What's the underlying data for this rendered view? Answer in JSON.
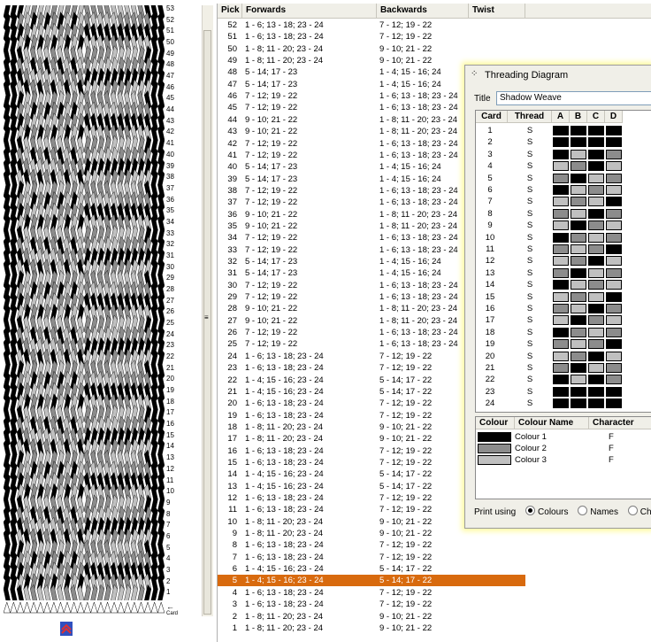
{
  "weave": {
    "colors": {
      "c1": "#000000",
      "c2": "#8c8c8c",
      "c3": "#c0c0c0"
    },
    "pick_numbers": [
      "53",
      "52",
      "51",
      "50",
      "49",
      "48",
      "47",
      "46",
      "45",
      "44",
      "43",
      "42",
      "41",
      "40",
      "39",
      "38",
      "37",
      "36",
      "35",
      "34",
      "33",
      "32",
      "31",
      "30",
      "29",
      "28",
      "27",
      "26",
      "25",
      "24",
      "23",
      "22",
      "21",
      "20",
      "19",
      "18",
      "17",
      "16",
      "15",
      "14",
      "13",
      "12",
      "11",
      "10",
      "9",
      "8",
      "7",
      "6",
      "5",
      "4",
      "3",
      "2",
      "1"
    ],
    "arrow_label": "←",
    "card_label": "Card"
  },
  "list": {
    "headers": {
      "pick": "Pick",
      "forwards": "Forwards",
      "backwards": "Backwards",
      "twist": "Twist"
    },
    "rows": [
      {
        "pick": "52",
        "fwd": "1 - 6; 13 - 18; 23 - 24",
        "bwd": "7 - 12; 19 - 22"
      },
      {
        "pick": "51",
        "fwd": "1 - 6; 13 - 18; 23 - 24",
        "bwd": "7 - 12; 19 - 22"
      },
      {
        "pick": "50",
        "fwd": "1 - 8; 11 - 20; 23 - 24",
        "bwd": "9 - 10; 21 - 22"
      },
      {
        "pick": "49",
        "fwd": "1 - 8; 11 - 20; 23 - 24",
        "bwd": "9 - 10; 21 - 22"
      },
      {
        "pick": "48",
        "fwd": "5 - 14; 17 - 23",
        "bwd": "1 - 4; 15 - 16; 24"
      },
      {
        "pick": "47",
        "fwd": "5 - 14; 17 - 23",
        "bwd": "1 - 4; 15 - 16; 24"
      },
      {
        "pick": "46",
        "fwd": "7 - 12; 19 - 22",
        "bwd": "1 - 6; 13 - 18; 23 - 24"
      },
      {
        "pick": "45",
        "fwd": "7 - 12; 19 - 22",
        "bwd": "1 - 6; 13 - 18; 23 - 24"
      },
      {
        "pick": "44",
        "fwd": "9 - 10; 21 - 22",
        "bwd": "1 - 8; 11 - 20; 23 - 24"
      },
      {
        "pick": "43",
        "fwd": "9 - 10; 21 - 22",
        "bwd": "1 - 8; 11 - 20; 23 - 24"
      },
      {
        "pick": "42",
        "fwd": "7 - 12; 19 - 22",
        "bwd": "1 - 6; 13 - 18; 23 - 24"
      },
      {
        "pick": "41",
        "fwd": "7 - 12; 19 - 22",
        "bwd": "1 - 6; 13 - 18; 23 - 24"
      },
      {
        "pick": "40",
        "fwd": "5 - 14; 17 - 23",
        "bwd": "1 - 4; 15 - 16; 24"
      },
      {
        "pick": "39",
        "fwd": "5 - 14; 17 - 23",
        "bwd": "1 - 4; 15 - 16; 24"
      },
      {
        "pick": "38",
        "fwd": "7 - 12; 19 - 22",
        "bwd": "1 - 6; 13 - 18; 23 - 24"
      },
      {
        "pick": "37",
        "fwd": "7 - 12; 19 - 22",
        "bwd": "1 - 6; 13 - 18; 23 - 24"
      },
      {
        "pick": "36",
        "fwd": "9 - 10; 21 - 22",
        "bwd": "1 - 8; 11 - 20; 23 - 24"
      },
      {
        "pick": "35",
        "fwd": "9 - 10; 21 - 22",
        "bwd": "1 - 8; 11 - 20; 23 - 24"
      },
      {
        "pick": "34",
        "fwd": "7 - 12; 19 - 22",
        "bwd": "1 - 6; 13 - 18; 23 - 24"
      },
      {
        "pick": "33",
        "fwd": "7 - 12; 19 - 22",
        "bwd": "1 - 6; 13 - 18; 23 - 24"
      },
      {
        "pick": "32",
        "fwd": "5 - 14; 17 - 23",
        "bwd": "1 - 4; 15 - 16; 24"
      },
      {
        "pick": "31",
        "fwd": "5 - 14; 17 - 23",
        "bwd": "1 - 4; 15 - 16; 24"
      },
      {
        "pick": "30",
        "fwd": "7 - 12; 19 - 22",
        "bwd": "1 - 6; 13 - 18; 23 - 24"
      },
      {
        "pick": "29",
        "fwd": "7 - 12; 19 - 22",
        "bwd": "1 - 6; 13 - 18; 23 - 24"
      },
      {
        "pick": "28",
        "fwd": "9 - 10; 21 - 22",
        "bwd": "1 - 8; 11 - 20; 23 - 24"
      },
      {
        "pick": "27",
        "fwd": "9 - 10; 21 - 22",
        "bwd": "1 - 8; 11 - 20; 23 - 24"
      },
      {
        "pick": "26",
        "fwd": "7 - 12; 19 - 22",
        "bwd": "1 - 6; 13 - 18; 23 - 24"
      },
      {
        "pick": "25",
        "fwd": "7 - 12; 19 - 22",
        "bwd": "1 - 6; 13 - 18; 23 - 24"
      },
      {
        "pick": "24",
        "fwd": "1 - 6; 13 - 18; 23 - 24",
        "bwd": "7 - 12; 19 - 22"
      },
      {
        "pick": "23",
        "fwd": "1 - 6; 13 - 18; 23 - 24",
        "bwd": "7 - 12; 19 - 22"
      },
      {
        "pick": "22",
        "fwd": "1 - 4; 15 - 16; 23 - 24",
        "bwd": "5 - 14; 17 - 22"
      },
      {
        "pick": "21",
        "fwd": "1 - 4; 15 - 16; 23 - 24",
        "bwd": "5 - 14; 17 - 22"
      },
      {
        "pick": "20",
        "fwd": "1 - 6; 13 - 18; 23 - 24",
        "bwd": "7 - 12; 19 - 22"
      },
      {
        "pick": "19",
        "fwd": "1 - 6; 13 - 18; 23 - 24",
        "bwd": "7 - 12; 19 - 22"
      },
      {
        "pick": "18",
        "fwd": "1 - 8; 11 - 20; 23 - 24",
        "bwd": "9 - 10; 21 - 22"
      },
      {
        "pick": "17",
        "fwd": "1 - 8; 11 - 20; 23 - 24",
        "bwd": "9 - 10; 21 - 22"
      },
      {
        "pick": "16",
        "fwd": "1 - 6; 13 - 18; 23 - 24",
        "bwd": "7 - 12; 19 - 22"
      },
      {
        "pick": "15",
        "fwd": "1 - 6; 13 - 18; 23 - 24",
        "bwd": "7 - 12; 19 - 22"
      },
      {
        "pick": "14",
        "fwd": "1 - 4; 15 - 16; 23 - 24",
        "bwd": "5 - 14; 17 - 22"
      },
      {
        "pick": "13",
        "fwd": "1 - 4; 15 - 16; 23 - 24",
        "bwd": "5 - 14; 17 - 22"
      },
      {
        "pick": "12",
        "fwd": "1 - 6; 13 - 18; 23 - 24",
        "bwd": "7 - 12; 19 - 22"
      },
      {
        "pick": "11",
        "fwd": "1 - 6; 13 - 18; 23 - 24",
        "bwd": "7 - 12; 19 - 22"
      },
      {
        "pick": "10",
        "fwd": "1 - 8; 11 - 20; 23 - 24",
        "bwd": "9 - 10; 21 - 22"
      },
      {
        "pick": "9",
        "fwd": "1 - 8; 11 - 20; 23 - 24",
        "bwd": "9 - 10; 21 - 22"
      },
      {
        "pick": "8",
        "fwd": "1 - 6; 13 - 18; 23 - 24",
        "bwd": "7 - 12; 19 - 22"
      },
      {
        "pick": "7",
        "fwd": "1 - 6; 13 - 18; 23 - 24",
        "bwd": "7 - 12; 19 - 22"
      },
      {
        "pick": "6",
        "fwd": "1 - 4; 15 - 16; 23 - 24",
        "bwd": "5 - 14; 17 - 22"
      },
      {
        "pick": "5",
        "fwd": "1 - 4; 15 - 16; 23 - 24",
        "bwd": "5 - 14; 17 - 22"
      },
      {
        "pick": "4",
        "fwd": "1 - 6; 13 - 18; 23 - 24",
        "bwd": "7 - 12; 19 - 22"
      },
      {
        "pick": "3",
        "fwd": "1 - 6; 13 - 18; 23 - 24",
        "bwd": "7 - 12; 19 - 22"
      },
      {
        "pick": "2",
        "fwd": "1 - 8; 11 - 20; 23 - 24",
        "bwd": "9 - 10; 21 - 22"
      },
      {
        "pick": "1",
        "fwd": "1 - 8; 11 - 20; 23 - 24",
        "bwd": "9 - 10; 21 - 22"
      }
    ],
    "selected_pick": "5",
    "selected_color": "#d86a0e"
  },
  "dialog": {
    "title": "Threading Diagram",
    "title_label": "Title",
    "title_value": "Shadow Weave",
    "grid_headers": {
      "card": "Card",
      "thread": "Thread",
      "a": "A",
      "b": "B",
      "c": "C",
      "d": "D"
    },
    "cards": [
      {
        "card": "1",
        "thread": "S",
        "holes": [
          1,
          1,
          1,
          1
        ]
      },
      {
        "card": "2",
        "thread": "S",
        "holes": [
          1,
          1,
          1,
          1
        ]
      },
      {
        "card": "3",
        "thread": "S",
        "holes": [
          1,
          3,
          1,
          2
        ]
      },
      {
        "card": "4",
        "thread": "S",
        "holes": [
          3,
          2,
          1,
          3
        ]
      },
      {
        "card": "5",
        "thread": "S",
        "holes": [
          2,
          1,
          3,
          2
        ]
      },
      {
        "card": "6",
        "thread": "S",
        "holes": [
          1,
          3,
          2,
          3
        ]
      },
      {
        "card": "7",
        "thread": "S",
        "holes": [
          3,
          2,
          3,
          1
        ]
      },
      {
        "card": "8",
        "thread": "S",
        "holes": [
          2,
          3,
          1,
          2
        ]
      },
      {
        "card": "9",
        "thread": "S",
        "holes": [
          3,
          1,
          2,
          3
        ]
      },
      {
        "card": "10",
        "thread": "S",
        "holes": [
          1,
          2,
          3,
          2
        ]
      },
      {
        "card": "11",
        "thread": "S",
        "holes": [
          2,
          3,
          2,
          1
        ]
      },
      {
        "card": "12",
        "thread": "S",
        "holes": [
          3,
          2,
          1,
          3
        ]
      },
      {
        "card": "13",
        "thread": "S",
        "holes": [
          2,
          1,
          3,
          2
        ]
      },
      {
        "card": "14",
        "thread": "S",
        "holes": [
          1,
          3,
          2,
          3
        ]
      },
      {
        "card": "15",
        "thread": "S",
        "holes": [
          3,
          2,
          3,
          1
        ]
      },
      {
        "card": "16",
        "thread": "S",
        "holes": [
          2,
          3,
          1,
          2
        ]
      },
      {
        "card": "17",
        "thread": "S",
        "holes": [
          3,
          1,
          2,
          3
        ]
      },
      {
        "card": "18",
        "thread": "S",
        "holes": [
          1,
          2,
          3,
          2
        ]
      },
      {
        "card": "19",
        "thread": "S",
        "holes": [
          2,
          3,
          2,
          1
        ]
      },
      {
        "card": "20",
        "thread": "S",
        "holes": [
          3,
          2,
          1,
          3
        ]
      },
      {
        "card": "21",
        "thread": "S",
        "holes": [
          2,
          1,
          3,
          2
        ]
      },
      {
        "card": "22",
        "thread": "S",
        "holes": [
          1,
          3,
          1,
          2
        ]
      },
      {
        "card": "23",
        "thread": "S",
        "holes": [
          1,
          1,
          1,
          1
        ]
      },
      {
        "card": "24",
        "thread": "S",
        "holes": [
          1,
          1,
          1,
          1
        ]
      }
    ],
    "colour_headers": {
      "colour": "Colour",
      "name": "Colour Name",
      "character": "Character"
    },
    "colours": [
      {
        "name": "Colour 1",
        "character": "F",
        "hex": "#000000"
      },
      {
        "name": "Colour 2",
        "character": "F",
        "hex": "#8c8c8c"
      },
      {
        "name": "Colour 3",
        "character": "F",
        "hex": "#c0c0c0"
      }
    ],
    "print_using_label": "Print using",
    "print_options": [
      "Colours",
      "Names",
      "Chara"
    ],
    "print_selected": "Colours"
  }
}
